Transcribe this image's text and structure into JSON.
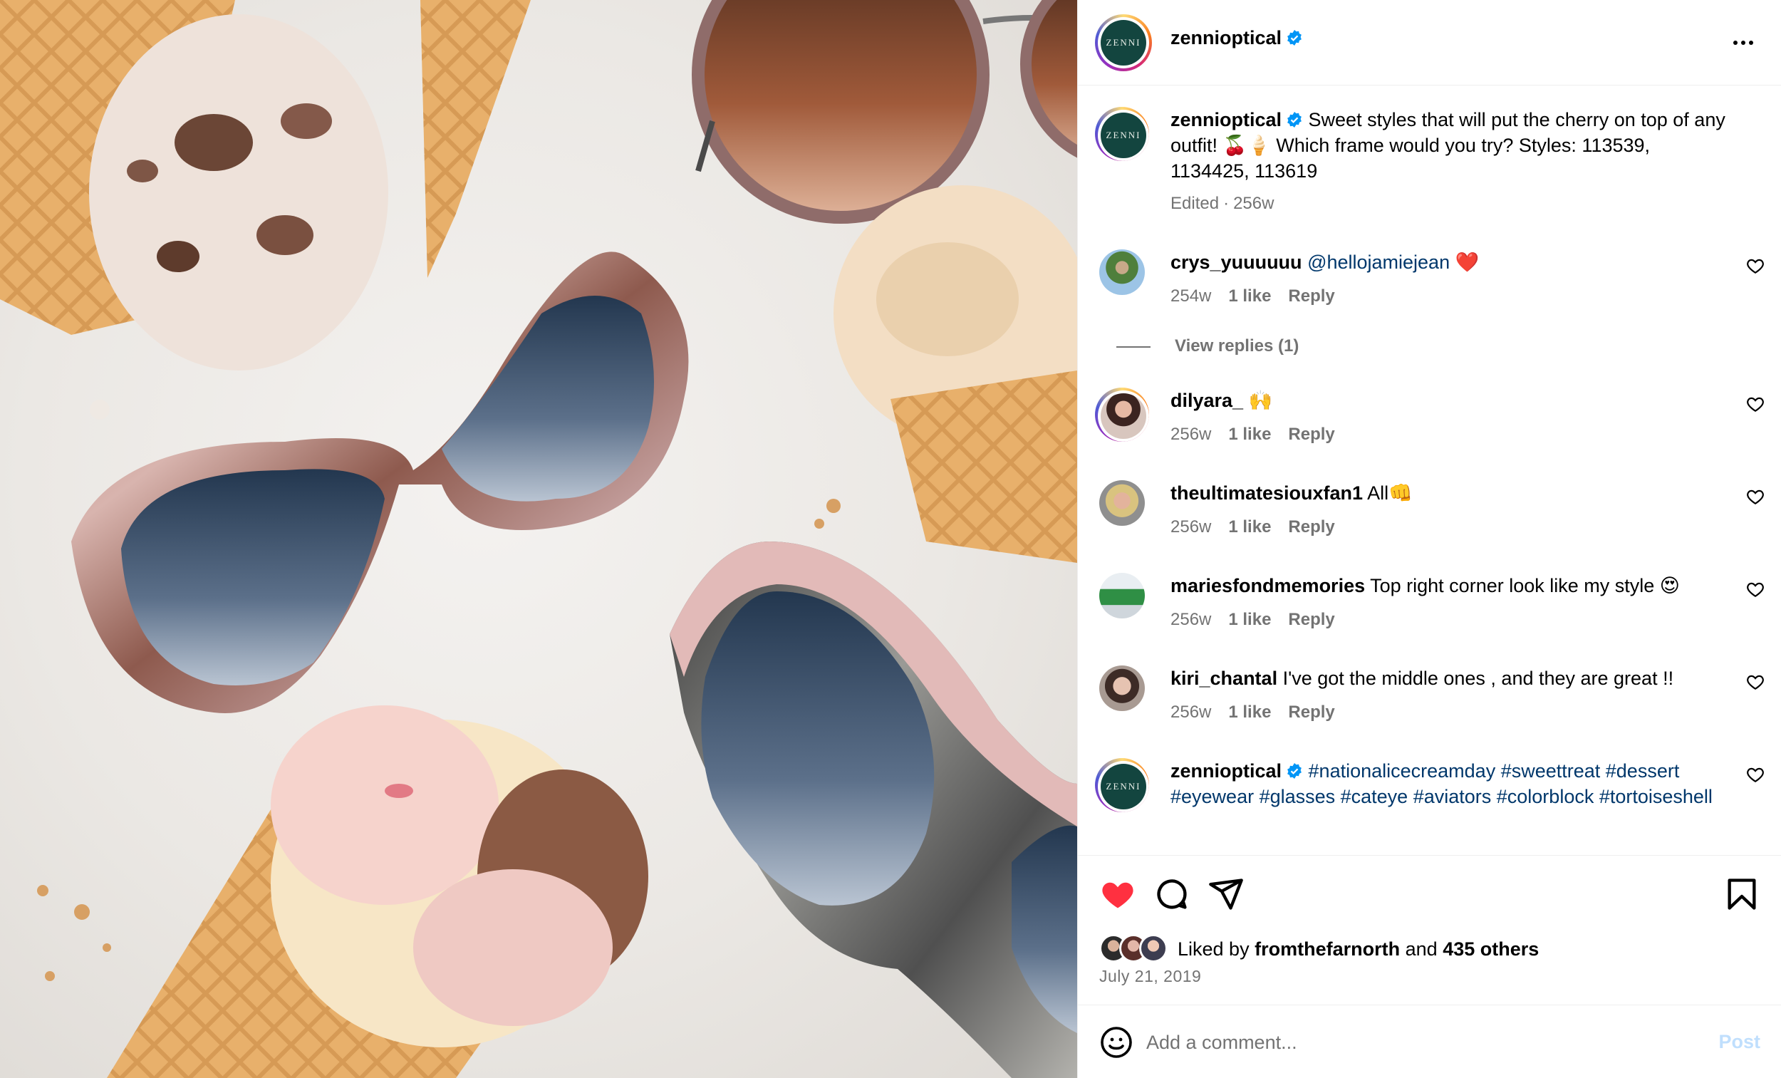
{
  "colors": {
    "link": "#00376b",
    "muted": "#737373",
    "like_red": "#ff3040",
    "post_disabled": "#c0dffd",
    "brand_green": "#13453f"
  },
  "photo": {
    "alt": "sunglasses and ice cream cones on marble"
  },
  "header": {
    "username": "zennioptical",
    "logo_text": "ZENNI",
    "more_icon": "more-horizontal-icon"
  },
  "caption": {
    "username": "zennioptical",
    "text": "Sweet styles that will put the cherry on top of any outfit! 🍒🍦 Which frame would you try? Styles: 113539, 1134425, 113619",
    "edited": "Edited",
    "separator": "·",
    "time": "256w"
  },
  "comments": [
    {
      "username": "crys_yuuuuuu",
      "mention": "@hellojamiejean",
      "text": " ❤️",
      "time": "254w",
      "likes": "1 like",
      "reply": "Reply",
      "view_replies": "View replies (1)"
    },
    {
      "username": "dilyara_",
      "text": "🙌",
      "time": "256w",
      "likes": "1 like",
      "reply": "Reply"
    },
    {
      "username": "theultimatesiouxfan1",
      "text": "All👊",
      "time": "256w",
      "likes": "1 like",
      "reply": "Reply"
    },
    {
      "username": "mariesfondmemories",
      "text": "Top right corner look like my style 😍",
      "time": "256w",
      "likes": "1 like",
      "reply": "Reply"
    },
    {
      "username": "kiri_chantal",
      "text": "I've got the middle ones , and they are great !!",
      "time": "256w",
      "likes": "1 like",
      "reply": "Reply"
    },
    {
      "username": "zennioptical",
      "tags": "#nationalicecreamday #sweettreat #dessert #eyewear #glasses #cateye #aviators #colorblock #tortoiseshell"
    }
  ],
  "actions": {
    "icons": [
      "heart-filled-icon",
      "comment-icon",
      "share-icon",
      "bookmark-icon"
    ],
    "liked_by_prefix": "Liked by",
    "liked_by_user": "fromthefarnorth",
    "and": "and",
    "others": "435 others",
    "date": "July 21, 2019"
  },
  "add_comment": {
    "placeholder": "Add a comment...",
    "post_label": "Post"
  }
}
